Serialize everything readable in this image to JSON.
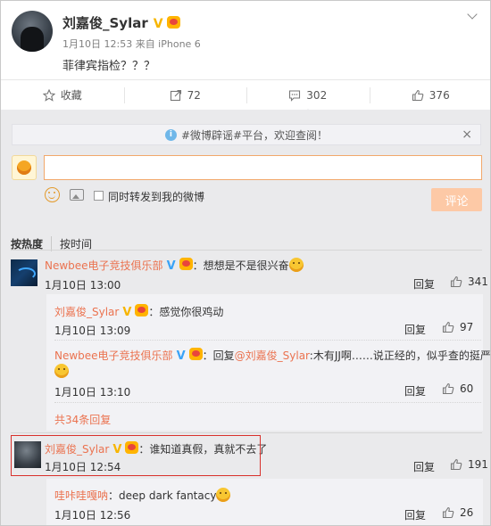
{
  "post": {
    "username": "刘嘉俊_Sylar",
    "v_badge": "V",
    "meta": "1月10日 12:53 来自 iPhone 6",
    "text": "菲律宾指检？？？"
  },
  "actions": {
    "favorite": "收藏",
    "repost": "72",
    "comment": "302",
    "like": "376"
  },
  "notice": {
    "text": "#微博辟谣#平台，欢迎查阅！",
    "close": "×"
  },
  "composer": {
    "checkbox_label": "同时转发到我的微博",
    "submit": "评论"
  },
  "sort": {
    "hot": "按热度",
    "time": "按时间"
  },
  "comments": [
    {
      "name": "Newbee电子竞技俱乐部",
      "text": "：想想是不是很兴奋",
      "time": "1月10日 13:00",
      "reply": "回复",
      "likes": "341"
    },
    {
      "name": "刘嘉俊_Sylar",
      "text": "：谁知道真假，真就不去了",
      "time": "1月10日 12:54",
      "reply": "回复",
      "likes": "191"
    },
    {
      "name": "哇咔哇嘎呐",
      "text": "：deep dark fantacy",
      "time": "1月10日 12:56",
      "reply": "回复",
      "likes": "26"
    }
  ],
  "replies": [
    {
      "name": "刘嘉俊_Sylar",
      "text": "：感觉你很鸡动",
      "time": "1月10日 13:09",
      "reply": "回复",
      "likes": "97"
    },
    {
      "name": "Newbee电子竞技俱乐部",
      "text_prefix": "：回复",
      "mention": "@刘嘉俊_Sylar",
      "text": ":木有JJ啊……说正经的，似乎查的挺严",
      "time": "1月10日 13:10",
      "reply": "回复",
      "likes": "60"
    }
  ],
  "more_replies": "共34条回复",
  "colors": {
    "name": "#eb7350",
    "highlight_border": "#d8312c",
    "submit_bg": "#fdc9a6",
    "comment_bg": "#eaeaec"
  }
}
